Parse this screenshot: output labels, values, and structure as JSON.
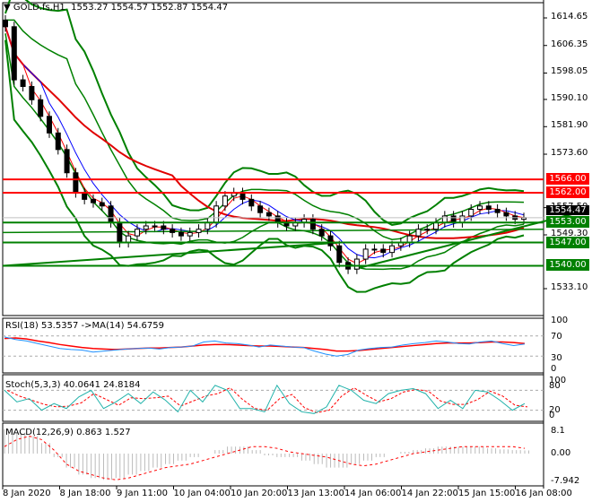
{
  "header": {
    "symbol": "GOLD.fs,H1",
    "ohlc": "1553.27 1554.57 1552.87 1554.47"
  },
  "colors": {
    "support": "#008000",
    "resistance": "#ff0000",
    "current": "#000000"
  },
  "price_axis": [
    "1614.65",
    "1606.35",
    "1598.05",
    "1590.10",
    "1581.90",
    "1573.60",
    "1557.50",
    "1549.30",
    "1533.10"
  ],
  "levels": [
    {
      "label": "1566.00",
      "value": 1566,
      "kind": "resistance"
    },
    {
      "label": "1562.00",
      "value": 1562,
      "kind": "resistance"
    },
    {
      "label": "1553.00",
      "value": 1553,
      "kind": "support"
    },
    {
      "label": "1547.00",
      "value": 1547,
      "kind": "support"
    },
    {
      "label": "1540.00",
      "value": 1540,
      "kind": "support"
    }
  ],
  "current_price": "1554.47",
  "rsi": {
    "title": "RSI(18) 53.5357  ->MA(14) 54.6759",
    "axis": [
      "100",
      "70",
      "30",
      "0"
    ]
  },
  "stoch": {
    "title": "Stoch(5,3,3) 40.0641 24.8184",
    "axis": [
      "100",
      "80",
      "20",
      "0"
    ]
  },
  "macd": {
    "title": "MACD(12,26,9) 0.863 1.527",
    "axis": [
      "8.1",
      "0.00",
      "-7.942"
    ]
  },
  "time_axis": [
    "8 Jan 2020",
    "8 Jan 18:00",
    "9 Jan 11:00",
    "10 Jan 04:00",
    "10 Jan 20:00",
    "13 Jan 13:00",
    "14 Jan 06:00",
    "14 Jan 22:00",
    "15 Jan 15:00",
    "16 Jan 08:00"
  ],
  "chart_data": {
    "type": "candlestick",
    "ylim": [
      1533.1,
      1614.65
    ],
    "closes": [
      1612,
      1596,
      1594,
      1590,
      1585,
      1580,
      1575,
      1568,
      1562,
      1560,
      1559,
      1558,
      1553,
      1547,
      1549,
      1551,
      1552,
      1552,
      1551,
      1550,
      1549,
      1550,
      1551,
      1553,
      1558,
      1561,
      1562,
      1560,
      1558,
      1556,
      1555,
      1553,
      1552,
      1553,
      1554,
      1551,
      1549,
      1546,
      1541,
      1539,
      1542,
      1545,
      1545,
      1544,
      1546,
      1547,
      1549,
      1551,
      1551,
      1553,
      1555,
      1553,
      1555,
      1557,
      1558,
      1557,
      1556,
      1555,
      1554,
      1554.5
    ],
    "rsi": [
      68,
      63,
      60,
      55,
      50,
      45,
      43,
      42,
      38,
      40,
      42,
      44,
      45,
      46,
      44,
      47,
      48,
      50,
      58,
      60,
      56,
      55,
      52,
      48,
      52,
      50,
      48,
      47,
      40,
      34,
      30,
      33,
      42,
      45,
      47,
      48,
      52,
      55,
      57,
      60,
      58,
      55,
      54,
      58,
      60,
      55,
      51,
      54
    ],
    "rsi_ma": [
      65,
      66,
      64,
      60,
      57,
      53,
      50,
      47,
      45,
      44,
      43,
      44,
      45,
      46,
      46,
      47,
      48,
      50,
      52,
      53,
      53,
      52,
      51,
      50,
      50,
      49,
      48,
      47,
      45,
      43,
      40,
      40,
      41,
      43,
      45,
      47,
      49,
      51,
      53,
      55,
      56,
      56,
      56,
      57,
      58,
      58,
      57,
      55
    ],
    "stoch": [
      80,
      45,
      55,
      20,
      40,
      25,
      60,
      80,
      25,
      45,
      70,
      40,
      75,
      50,
      15,
      80,
      45,
      95,
      80,
      25,
      25,
      15,
      95,
      40,
      15,
      10,
      30,
      95,
      80,
      50,
      40,
      70,
      80,
      85,
      70,
      25,
      50,
      25,
      80,
      75,
      50,
      20,
      40
    ],
    "macd_hist": [
      7,
      6,
      5,
      3,
      -1,
      -4,
      -6,
      -7,
      -7.5,
      -7,
      -6,
      -5,
      -4,
      -3,
      -2,
      -1,
      0,
      1,
      2,
      2,
      1,
      -0.5,
      -1,
      -1,
      -2,
      -3,
      -4,
      -4,
      -3,
      -2,
      -1,
      0,
      0.5,
      1,
      1.5,
      2,
      2,
      2,
      2,
      1.5,
      1.2,
      1,
      0.9
    ],
    "macd_signal": [
      2,
      4,
      5,
      4,
      1,
      -3,
      -5,
      -6,
      -7,
      -7.5,
      -7,
      -6,
      -5,
      -4,
      -3.5,
      -3,
      -2,
      -1,
      0,
      1,
      2,
      2,
      1.5,
      0.5,
      0,
      -0.5,
      -1,
      -2,
      -3,
      -3.5,
      -3,
      -2,
      -1,
      0,
      0.5,
      1,
      1.5,
      2,
      2,
      2,
      2,
      2,
      1.5
    ]
  }
}
